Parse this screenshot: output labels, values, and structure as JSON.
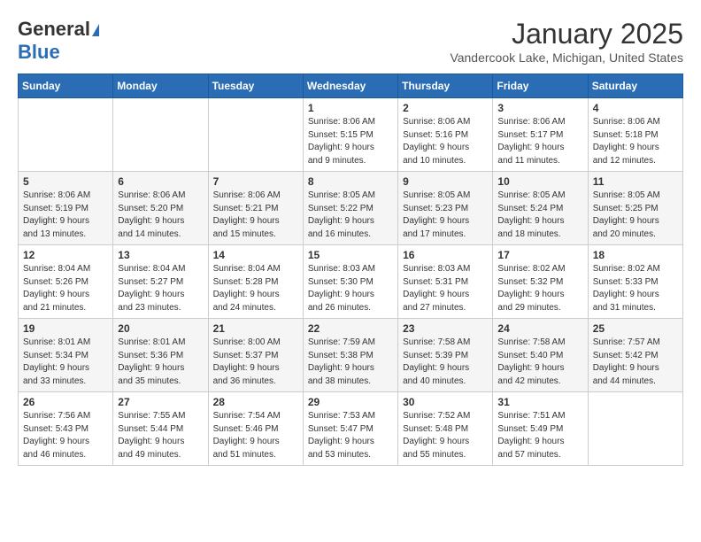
{
  "logo": {
    "general": "General",
    "blue": "Blue"
  },
  "header": {
    "month": "January 2025",
    "location": "Vandercook Lake, Michigan, United States"
  },
  "days_of_week": [
    "Sunday",
    "Monday",
    "Tuesday",
    "Wednesday",
    "Thursday",
    "Friday",
    "Saturday"
  ],
  "weeks": [
    [
      {
        "day": "",
        "info": ""
      },
      {
        "day": "",
        "info": ""
      },
      {
        "day": "",
        "info": ""
      },
      {
        "day": "1",
        "info": "Sunrise: 8:06 AM\nSunset: 5:15 PM\nDaylight: 9 hours\nand 9 minutes."
      },
      {
        "day": "2",
        "info": "Sunrise: 8:06 AM\nSunset: 5:16 PM\nDaylight: 9 hours\nand 10 minutes."
      },
      {
        "day": "3",
        "info": "Sunrise: 8:06 AM\nSunset: 5:17 PM\nDaylight: 9 hours\nand 11 minutes."
      },
      {
        "day": "4",
        "info": "Sunrise: 8:06 AM\nSunset: 5:18 PM\nDaylight: 9 hours\nand 12 minutes."
      }
    ],
    [
      {
        "day": "5",
        "info": "Sunrise: 8:06 AM\nSunset: 5:19 PM\nDaylight: 9 hours\nand 13 minutes."
      },
      {
        "day": "6",
        "info": "Sunrise: 8:06 AM\nSunset: 5:20 PM\nDaylight: 9 hours\nand 14 minutes."
      },
      {
        "day": "7",
        "info": "Sunrise: 8:06 AM\nSunset: 5:21 PM\nDaylight: 9 hours\nand 15 minutes."
      },
      {
        "day": "8",
        "info": "Sunrise: 8:05 AM\nSunset: 5:22 PM\nDaylight: 9 hours\nand 16 minutes."
      },
      {
        "day": "9",
        "info": "Sunrise: 8:05 AM\nSunset: 5:23 PM\nDaylight: 9 hours\nand 17 minutes."
      },
      {
        "day": "10",
        "info": "Sunrise: 8:05 AM\nSunset: 5:24 PM\nDaylight: 9 hours\nand 18 minutes."
      },
      {
        "day": "11",
        "info": "Sunrise: 8:05 AM\nSunset: 5:25 PM\nDaylight: 9 hours\nand 20 minutes."
      }
    ],
    [
      {
        "day": "12",
        "info": "Sunrise: 8:04 AM\nSunset: 5:26 PM\nDaylight: 9 hours\nand 21 minutes."
      },
      {
        "day": "13",
        "info": "Sunrise: 8:04 AM\nSunset: 5:27 PM\nDaylight: 9 hours\nand 23 minutes."
      },
      {
        "day": "14",
        "info": "Sunrise: 8:04 AM\nSunset: 5:28 PM\nDaylight: 9 hours\nand 24 minutes."
      },
      {
        "day": "15",
        "info": "Sunrise: 8:03 AM\nSunset: 5:30 PM\nDaylight: 9 hours\nand 26 minutes."
      },
      {
        "day": "16",
        "info": "Sunrise: 8:03 AM\nSunset: 5:31 PM\nDaylight: 9 hours\nand 27 minutes."
      },
      {
        "day": "17",
        "info": "Sunrise: 8:02 AM\nSunset: 5:32 PM\nDaylight: 9 hours\nand 29 minutes."
      },
      {
        "day": "18",
        "info": "Sunrise: 8:02 AM\nSunset: 5:33 PM\nDaylight: 9 hours\nand 31 minutes."
      }
    ],
    [
      {
        "day": "19",
        "info": "Sunrise: 8:01 AM\nSunset: 5:34 PM\nDaylight: 9 hours\nand 33 minutes."
      },
      {
        "day": "20",
        "info": "Sunrise: 8:01 AM\nSunset: 5:36 PM\nDaylight: 9 hours\nand 35 minutes."
      },
      {
        "day": "21",
        "info": "Sunrise: 8:00 AM\nSunset: 5:37 PM\nDaylight: 9 hours\nand 36 minutes."
      },
      {
        "day": "22",
        "info": "Sunrise: 7:59 AM\nSunset: 5:38 PM\nDaylight: 9 hours\nand 38 minutes."
      },
      {
        "day": "23",
        "info": "Sunrise: 7:58 AM\nSunset: 5:39 PM\nDaylight: 9 hours\nand 40 minutes."
      },
      {
        "day": "24",
        "info": "Sunrise: 7:58 AM\nSunset: 5:40 PM\nDaylight: 9 hours\nand 42 minutes."
      },
      {
        "day": "25",
        "info": "Sunrise: 7:57 AM\nSunset: 5:42 PM\nDaylight: 9 hours\nand 44 minutes."
      }
    ],
    [
      {
        "day": "26",
        "info": "Sunrise: 7:56 AM\nSunset: 5:43 PM\nDaylight: 9 hours\nand 46 minutes."
      },
      {
        "day": "27",
        "info": "Sunrise: 7:55 AM\nSunset: 5:44 PM\nDaylight: 9 hours\nand 49 minutes."
      },
      {
        "day": "28",
        "info": "Sunrise: 7:54 AM\nSunset: 5:46 PM\nDaylight: 9 hours\nand 51 minutes."
      },
      {
        "day": "29",
        "info": "Sunrise: 7:53 AM\nSunset: 5:47 PM\nDaylight: 9 hours\nand 53 minutes."
      },
      {
        "day": "30",
        "info": "Sunrise: 7:52 AM\nSunset: 5:48 PM\nDaylight: 9 hours\nand 55 minutes."
      },
      {
        "day": "31",
        "info": "Sunrise: 7:51 AM\nSunset: 5:49 PM\nDaylight: 9 hours\nand 57 minutes."
      },
      {
        "day": "",
        "info": ""
      }
    ]
  ]
}
